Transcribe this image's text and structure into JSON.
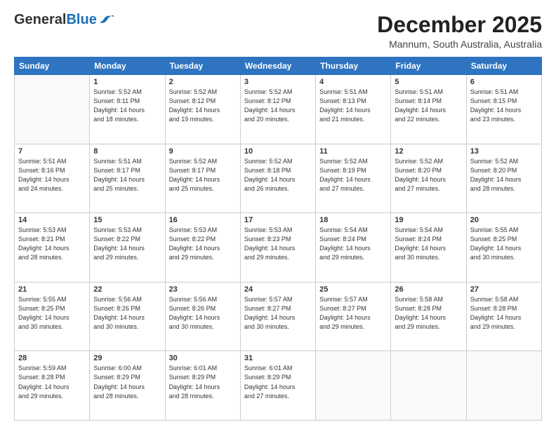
{
  "logo": {
    "general": "General",
    "blue": "Blue"
  },
  "header": {
    "title": "December 2025",
    "subtitle": "Mannum, South Australia, Australia"
  },
  "days_of_week": [
    "Sunday",
    "Monday",
    "Tuesday",
    "Wednesday",
    "Thursday",
    "Friday",
    "Saturday"
  ],
  "weeks": [
    [
      {
        "day": "",
        "info": ""
      },
      {
        "day": "1",
        "info": "Sunrise: 5:52 AM\nSunset: 8:11 PM\nDaylight: 14 hours\nand 18 minutes."
      },
      {
        "day": "2",
        "info": "Sunrise: 5:52 AM\nSunset: 8:12 PM\nDaylight: 14 hours\nand 19 minutes."
      },
      {
        "day": "3",
        "info": "Sunrise: 5:52 AM\nSunset: 8:12 PM\nDaylight: 14 hours\nand 20 minutes."
      },
      {
        "day": "4",
        "info": "Sunrise: 5:51 AM\nSunset: 8:13 PM\nDaylight: 14 hours\nand 21 minutes."
      },
      {
        "day": "5",
        "info": "Sunrise: 5:51 AM\nSunset: 8:14 PM\nDaylight: 14 hours\nand 22 minutes."
      },
      {
        "day": "6",
        "info": "Sunrise: 5:51 AM\nSunset: 8:15 PM\nDaylight: 14 hours\nand 23 minutes."
      }
    ],
    [
      {
        "day": "7",
        "info": "Sunrise: 5:51 AM\nSunset: 8:16 PM\nDaylight: 14 hours\nand 24 minutes."
      },
      {
        "day": "8",
        "info": "Sunrise: 5:51 AM\nSunset: 8:17 PM\nDaylight: 14 hours\nand 25 minutes."
      },
      {
        "day": "9",
        "info": "Sunrise: 5:52 AM\nSunset: 8:17 PM\nDaylight: 14 hours\nand 25 minutes."
      },
      {
        "day": "10",
        "info": "Sunrise: 5:52 AM\nSunset: 8:18 PM\nDaylight: 14 hours\nand 26 minutes."
      },
      {
        "day": "11",
        "info": "Sunrise: 5:52 AM\nSunset: 8:19 PM\nDaylight: 14 hours\nand 27 minutes."
      },
      {
        "day": "12",
        "info": "Sunrise: 5:52 AM\nSunset: 8:20 PM\nDaylight: 14 hours\nand 27 minutes."
      },
      {
        "day": "13",
        "info": "Sunrise: 5:52 AM\nSunset: 8:20 PM\nDaylight: 14 hours\nand 28 minutes."
      }
    ],
    [
      {
        "day": "14",
        "info": "Sunrise: 5:53 AM\nSunset: 8:21 PM\nDaylight: 14 hours\nand 28 minutes."
      },
      {
        "day": "15",
        "info": "Sunrise: 5:53 AM\nSunset: 8:22 PM\nDaylight: 14 hours\nand 29 minutes."
      },
      {
        "day": "16",
        "info": "Sunrise: 5:53 AM\nSunset: 8:22 PM\nDaylight: 14 hours\nand 29 minutes."
      },
      {
        "day": "17",
        "info": "Sunrise: 5:53 AM\nSunset: 8:23 PM\nDaylight: 14 hours\nand 29 minutes."
      },
      {
        "day": "18",
        "info": "Sunrise: 5:54 AM\nSunset: 8:24 PM\nDaylight: 14 hours\nand 29 minutes."
      },
      {
        "day": "19",
        "info": "Sunrise: 5:54 AM\nSunset: 8:24 PM\nDaylight: 14 hours\nand 30 minutes."
      },
      {
        "day": "20",
        "info": "Sunrise: 5:55 AM\nSunset: 8:25 PM\nDaylight: 14 hours\nand 30 minutes."
      }
    ],
    [
      {
        "day": "21",
        "info": "Sunrise: 5:55 AM\nSunset: 8:25 PM\nDaylight: 14 hours\nand 30 minutes."
      },
      {
        "day": "22",
        "info": "Sunrise: 5:56 AM\nSunset: 8:26 PM\nDaylight: 14 hours\nand 30 minutes."
      },
      {
        "day": "23",
        "info": "Sunrise: 5:56 AM\nSunset: 8:26 PM\nDaylight: 14 hours\nand 30 minutes."
      },
      {
        "day": "24",
        "info": "Sunrise: 5:57 AM\nSunset: 8:27 PM\nDaylight: 14 hours\nand 30 minutes."
      },
      {
        "day": "25",
        "info": "Sunrise: 5:57 AM\nSunset: 8:27 PM\nDaylight: 14 hours\nand 29 minutes."
      },
      {
        "day": "26",
        "info": "Sunrise: 5:58 AM\nSunset: 8:28 PM\nDaylight: 14 hours\nand 29 minutes."
      },
      {
        "day": "27",
        "info": "Sunrise: 5:58 AM\nSunset: 8:28 PM\nDaylight: 14 hours\nand 29 minutes."
      }
    ],
    [
      {
        "day": "28",
        "info": "Sunrise: 5:59 AM\nSunset: 8:28 PM\nDaylight: 14 hours\nand 29 minutes."
      },
      {
        "day": "29",
        "info": "Sunrise: 6:00 AM\nSunset: 8:29 PM\nDaylight: 14 hours\nand 28 minutes."
      },
      {
        "day": "30",
        "info": "Sunrise: 6:01 AM\nSunset: 8:29 PM\nDaylight: 14 hours\nand 28 minutes."
      },
      {
        "day": "31",
        "info": "Sunrise: 6:01 AM\nSunset: 8:29 PM\nDaylight: 14 hours\nand 27 minutes."
      },
      {
        "day": "",
        "info": ""
      },
      {
        "day": "",
        "info": ""
      },
      {
        "day": "",
        "info": ""
      }
    ]
  ]
}
